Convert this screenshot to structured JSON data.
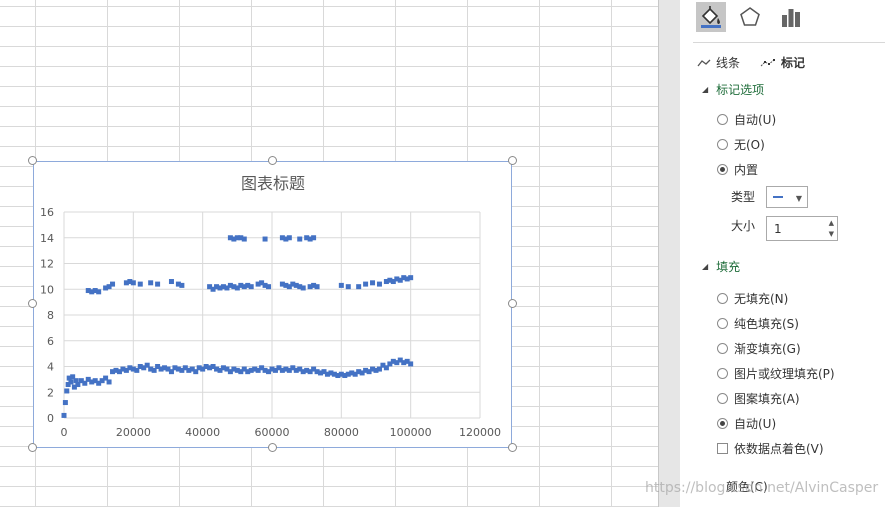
{
  "sheet": {},
  "chart": {
    "title": "图表标题"
  },
  "chart_data": {
    "type": "scatter",
    "title": "图表标题",
    "xlabel": "",
    "ylabel": "",
    "xlim": [
      0,
      120000
    ],
    "ylim": [
      0,
      16
    ],
    "x_ticks": [
      "0",
      "20000",
      "40000",
      "60000",
      "80000",
      "100000",
      "120000"
    ],
    "y_ticks": [
      "0",
      "2",
      "4",
      "6",
      "8",
      "10",
      "12",
      "14",
      "16"
    ],
    "grid": true,
    "legend": "none",
    "marker_color": "#4472c4",
    "series": [
      {
        "points": [
          [
            0,
            0.2
          ],
          [
            400,
            1.2
          ],
          [
            800,
            2.1
          ],
          [
            1200,
            2.6
          ],
          [
            1500,
            3.1
          ],
          [
            2000,
            2.8
          ],
          [
            2500,
            3.2
          ],
          [
            3000,
            2.4
          ],
          [
            3500,
            2.9
          ],
          [
            4000,
            2.6
          ],
          [
            5000,
            2.9
          ],
          [
            6000,
            2.7
          ],
          [
            7000,
            3.0
          ],
          [
            8000,
            2.8
          ],
          [
            9000,
            2.9
          ],
          [
            10000,
            2.7
          ],
          [
            11000,
            2.9
          ],
          [
            12000,
            3.1
          ],
          [
            13000,
            2.8
          ],
          [
            14000,
            3.6
          ],
          [
            15000,
            3.7
          ],
          [
            16000,
            3.6
          ],
          [
            17000,
            3.8
          ],
          [
            18000,
            3.7
          ],
          [
            19000,
            3.9
          ],
          [
            20000,
            3.8
          ],
          [
            21000,
            3.7
          ],
          [
            22000,
            4.0
          ],
          [
            23000,
            3.9
          ],
          [
            24000,
            4.1
          ],
          [
            25000,
            3.8
          ],
          [
            26000,
            3.7
          ],
          [
            27000,
            4.0
          ],
          [
            28000,
            3.8
          ],
          [
            29000,
            3.9
          ],
          [
            30000,
            3.8
          ],
          [
            31000,
            3.6
          ],
          [
            32000,
            3.9
          ],
          [
            33000,
            3.8
          ],
          [
            34000,
            3.7
          ],
          [
            35000,
            3.9
          ],
          [
            36000,
            3.7
          ],
          [
            37000,
            3.8
          ],
          [
            38000,
            3.6
          ],
          [
            39000,
            3.9
          ],
          [
            40000,
            3.8
          ],
          [
            41000,
            4.0
          ],
          [
            42000,
            3.9
          ],
          [
            43000,
            4.0
          ],
          [
            44000,
            3.8
          ],
          [
            45000,
            3.7
          ],
          [
            46000,
            3.9
          ],
          [
            47000,
            3.8
          ],
          [
            48000,
            3.6
          ],
          [
            49000,
            3.8
          ],
          [
            50000,
            3.7
          ],
          [
            51000,
            3.6
          ],
          [
            52000,
            3.8
          ],
          [
            53000,
            3.6
          ],
          [
            54000,
            3.7
          ],
          [
            55000,
            3.8
          ],
          [
            56000,
            3.7
          ],
          [
            57000,
            3.9
          ],
          [
            58000,
            3.7
          ],
          [
            59000,
            3.6
          ],
          [
            60000,
            3.8
          ],
          [
            61000,
            3.7
          ],
          [
            62000,
            3.9
          ],
          [
            63000,
            3.7
          ],
          [
            64000,
            3.8
          ],
          [
            65000,
            3.7
          ],
          [
            66000,
            3.9
          ],
          [
            67000,
            3.7
          ],
          [
            68000,
            3.8
          ],
          [
            69000,
            3.6
          ],
          [
            70000,
            3.7
          ],
          [
            71000,
            3.6
          ],
          [
            72000,
            3.8
          ],
          [
            73000,
            3.6
          ],
          [
            74000,
            3.5
          ],
          [
            75000,
            3.6
          ],
          [
            76000,
            3.4
          ],
          [
            77000,
            3.5
          ],
          [
            78000,
            3.4
          ],
          [
            79000,
            3.3
          ],
          [
            80000,
            3.4
          ],
          [
            81000,
            3.3
          ],
          [
            82000,
            3.4
          ],
          [
            83000,
            3.5
          ],
          [
            84000,
            3.4
          ],
          [
            85000,
            3.6
          ],
          [
            86000,
            3.5
          ],
          [
            87000,
            3.7
          ],
          [
            88000,
            3.6
          ],
          [
            89000,
            3.8
          ],
          [
            90000,
            3.7
          ],
          [
            91000,
            3.8
          ],
          [
            92000,
            4.1
          ],
          [
            93000,
            3.9
          ],
          [
            94000,
            4.2
          ],
          [
            95000,
            4.4
          ],
          [
            96000,
            4.3
          ],
          [
            97000,
            4.5
          ],
          [
            98000,
            4.3
          ],
          [
            99000,
            4.4
          ],
          [
            100000,
            4.2
          ],
          [
            7000,
            9.9
          ],
          [
            8000,
            9.8
          ],
          [
            9000,
            9.9
          ],
          [
            10000,
            9.8
          ],
          [
            12000,
            10.1
          ],
          [
            13000,
            10.2
          ],
          [
            14000,
            10.4
          ],
          [
            18000,
            10.5
          ],
          [
            19000,
            10.6
          ],
          [
            20000,
            10.5
          ],
          [
            22000,
            10.4
          ],
          [
            25000,
            10.5
          ],
          [
            27000,
            10.4
          ],
          [
            31000,
            10.6
          ],
          [
            33000,
            10.4
          ],
          [
            34000,
            10.3
          ],
          [
            42000,
            10.2
          ],
          [
            43000,
            10.0
          ],
          [
            44000,
            10.2
          ],
          [
            45000,
            10.1
          ],
          [
            46000,
            10.2
          ],
          [
            47000,
            10.1
          ],
          [
            48000,
            10.3
          ],
          [
            49000,
            10.2
          ],
          [
            50000,
            10.1
          ],
          [
            51000,
            10.3
          ],
          [
            52000,
            10.2
          ],
          [
            53000,
            10.3
          ],
          [
            54000,
            10.2
          ],
          [
            56000,
            10.4
          ],
          [
            57000,
            10.5
          ],
          [
            58000,
            10.3
          ],
          [
            59000,
            10.2
          ],
          [
            63000,
            10.4
          ],
          [
            64000,
            10.3
          ],
          [
            65000,
            10.2
          ],
          [
            66000,
            10.4
          ],
          [
            67000,
            10.3
          ],
          [
            68000,
            10.2
          ],
          [
            69000,
            10.1
          ],
          [
            71000,
            10.2
          ],
          [
            72000,
            10.3
          ],
          [
            73000,
            10.2
          ],
          [
            80000,
            10.3
          ],
          [
            82000,
            10.2
          ],
          [
            85000,
            10.2
          ],
          [
            87000,
            10.4
          ],
          [
            89000,
            10.5
          ],
          [
            91000,
            10.4
          ],
          [
            93000,
            10.6
          ],
          [
            94000,
            10.7
          ],
          [
            95000,
            10.6
          ],
          [
            96000,
            10.8
          ],
          [
            97000,
            10.7
          ],
          [
            98000,
            10.9
          ],
          [
            99000,
            10.8
          ],
          [
            100000,
            10.9
          ],
          [
            48000,
            14.0
          ],
          [
            49000,
            13.9
          ],
          [
            50000,
            14.0
          ],
          [
            51000,
            14.0
          ],
          [
            52000,
            13.9
          ],
          [
            58000,
            13.9
          ],
          [
            63000,
            14.0
          ],
          [
            64000,
            13.9
          ],
          [
            65000,
            14.0
          ],
          [
            68000,
            13.9
          ],
          [
            70000,
            14.0
          ],
          [
            71000,
            13.9
          ],
          [
            72000,
            14.0
          ]
        ]
      }
    ]
  },
  "pane": {
    "tabs": [
      "填充与线条",
      "效果",
      "系列选项"
    ],
    "subtab_line": "线条",
    "subtab_marker": "标记",
    "marker_options": {
      "title": "标记选项",
      "auto": "自动(U)",
      "none": "无(O)",
      "builtin": "内置",
      "type_label": "类型",
      "size_label": "大小",
      "size_value": "1"
    },
    "fill": {
      "title": "填充",
      "no_fill": "无填充(N)",
      "solid": "纯色填充(S)",
      "gradient": "渐变填充(G)",
      "picture": "图片或纹理填充(P)",
      "pattern": "图案填充(A)",
      "auto": "自动(U)",
      "vary": "依数据点着色(V)",
      "color": "颜色(C)"
    },
    "accent": "#4472c4"
  },
  "watermark": "https://blog.csdn.net/AlvinCasper"
}
